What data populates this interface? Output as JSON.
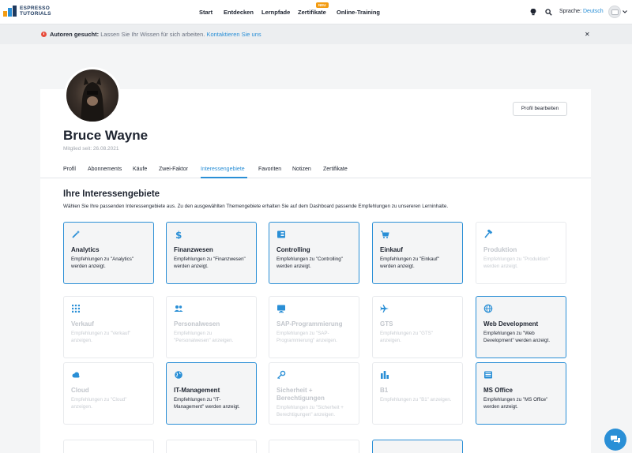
{
  "logo": {
    "line1": "ESPRESSO",
    "line2": "TUTORIALS"
  },
  "nav": {
    "items": [
      {
        "label": "Start"
      },
      {
        "label": "Entdecken"
      },
      {
        "label": "Lernpfade"
      },
      {
        "label": "Zertifikate",
        "badge": "NEU"
      },
      {
        "label": "Online-Training"
      }
    ]
  },
  "header": {
    "language_label": "Sprache:",
    "language_value": "Deutsch"
  },
  "notice": {
    "title": "Autoren gesucht:",
    "text": "Lassen Sie Ihr Wissen für sich arbeiten.",
    "link": "Kontaktieren Sie uns",
    "close": "✕"
  },
  "profile": {
    "name": "Bruce Wayne",
    "member_since": "Mitglied seit: 26.08.2021",
    "edit_button": "Profil bearbeiten"
  },
  "tabs": [
    {
      "label": "Profil"
    },
    {
      "label": "Abonnements"
    },
    {
      "label": "Käufe"
    },
    {
      "label": "Zwei-Faktor"
    },
    {
      "label": "Interessengebiete",
      "active": true
    },
    {
      "label": "Favoriten"
    },
    {
      "label": "Notizen"
    },
    {
      "label": "Zertifikate"
    }
  ],
  "interests": {
    "title": "Ihre Interessengebiete",
    "description": "Wählen Sie Ihre passenden Interessengebiete aus. Zu den ausgewählten Themengebiete erhalten Sie auf dem Dashboard passende Empfehlungen zu unsereren Lerninhalte.",
    "tiles": [
      {
        "title": "Analytics",
        "desc": "Empfehlungen zu \"Analytics\" werden anzeigt.",
        "icon": "wand-icon",
        "selected": true
      },
      {
        "title": "Finanzwesen",
        "desc": "Empfehlungen zu \"Finanzwesen\" werden anzeigt.",
        "icon": "dollar-icon",
        "selected": true
      },
      {
        "title": "Controlling",
        "desc": "Empfehlungen zu \"Controlling\" werden anzeigt.",
        "icon": "ledger-icon",
        "selected": true
      },
      {
        "title": "Einkauf",
        "desc": "Empfehlungen zu \"Einkauf\" werden anzeigt.",
        "icon": "cart-icon",
        "selected": true
      },
      {
        "title": "Produktion",
        "desc": "Empfehlungen zu \"Produktion\" werden anzeigt.",
        "icon": "hammer-icon",
        "selected": false
      },
      {
        "title": "Verkauf",
        "desc": "Empfehlungen zu \"Verkauf\" anzeigen.",
        "icon": "grid-icon",
        "selected": false
      },
      {
        "title": "Personalwesen",
        "desc": "Empfehlungen zu \"Personalwesen\" anzeigen.",
        "icon": "people-icon",
        "selected": false
      },
      {
        "title": "SAP-Programmierung",
        "desc": "Empfehlungen zu \"SAP-Programmierung\" anzeigen.",
        "icon": "monitor-icon",
        "selected": false
      },
      {
        "title": "GTS",
        "desc": "Empfehlungen zu \"GTS\" anzeigen.",
        "icon": "plane-icon",
        "selected": false
      },
      {
        "title": "Web Development",
        "desc": "Empfehlungen zu \"Web Development\" werden anzeigt.",
        "icon": "globe-icon",
        "selected": true
      },
      {
        "title": "Cloud",
        "desc": "Empfehlungen zu \"Cloud\" anzeigen.",
        "icon": "cloud-icon",
        "selected": false
      },
      {
        "title": "IT-Management",
        "desc": "Empfehlungen zu \"IT-Management\" werden anzeigt.",
        "icon": "earth-icon",
        "selected": true
      },
      {
        "title": "Sicherheit + Berechtigungen",
        "desc": "Empfehlungen zu \"Sicherheit + Berechtigungen\" anzeigen.",
        "icon": "key-icon",
        "selected": false
      },
      {
        "title": "B1",
        "desc": "Empfehlungen zu \"B1\" anzeigen.",
        "icon": "bars-icon",
        "selected": false
      },
      {
        "title": "MS Office",
        "desc": "Empfehlungen zu \"MS Office\" werden anzeigt.",
        "icon": "office-icon",
        "selected": true
      }
    ]
  },
  "colors": {
    "accent": "#2a8fd6",
    "badge": "#f39c12",
    "text": "#1e2430"
  }
}
